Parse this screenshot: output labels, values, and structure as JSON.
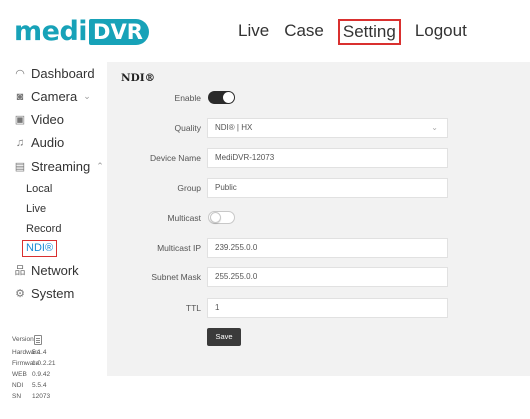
{
  "logo": {
    "part1": "medi",
    "part2": "DVR"
  },
  "topnav": [
    {
      "label": "Live"
    },
    {
      "label": "Case"
    },
    {
      "label": "Setting",
      "active": true
    },
    {
      "label": "Logout"
    }
  ],
  "sidebar": {
    "dashboard": "Dashboard",
    "camera": "Camera",
    "video": "Video",
    "audio": "Audio",
    "streaming": "Streaming",
    "streaming_sub": [
      "Local",
      "Live",
      "Record",
      "NDI®"
    ],
    "network": "Network",
    "system": "System",
    "icons": {
      "dashboard": "gauge-icon",
      "camera": "camera-icon",
      "video": "video-icon",
      "audio": "audio-icon",
      "streaming": "streaming-icon",
      "network": "network-icon",
      "system": "gear-icon"
    }
  },
  "version_info": {
    "version_label": "Version",
    "rows": [
      {
        "key": "Hardware",
        "value": "5.1.4"
      },
      {
        "key": "Firmware",
        "value": "1.0.2.21"
      },
      {
        "key": "WEB",
        "value": "0.9.42"
      },
      {
        "key": "NDI",
        "value": "5.5.4"
      },
      {
        "key": "SN",
        "value": "12073"
      }
    ]
  },
  "ndi": {
    "title": "NDI®",
    "enable_label": "Enable",
    "enable_on": true,
    "quality_label": "Quality",
    "quality_value": "NDI® | HX",
    "device_name_label": "Device Name",
    "device_name_value": "MediDVR-12073",
    "group_label": "Group",
    "group_value": "Public",
    "multicast_label": "Multicast",
    "multicast_on": false,
    "multicast_ip_label": "Multicast IP",
    "multicast_ip_value": "239.255.0.0",
    "subnet_mask_label": "Subnet Mask",
    "subnet_mask_value": "255.255.0.0",
    "ttl_label": "TTL",
    "ttl_value": "1",
    "save_label": "Save"
  },
  "colors": {
    "brand": "#17a2b8",
    "highlight_border": "#d9302f",
    "active_link": "#1a8bd6",
    "panel_bg": "#f2f2f2",
    "toggle_on": "#2b2b2b"
  }
}
